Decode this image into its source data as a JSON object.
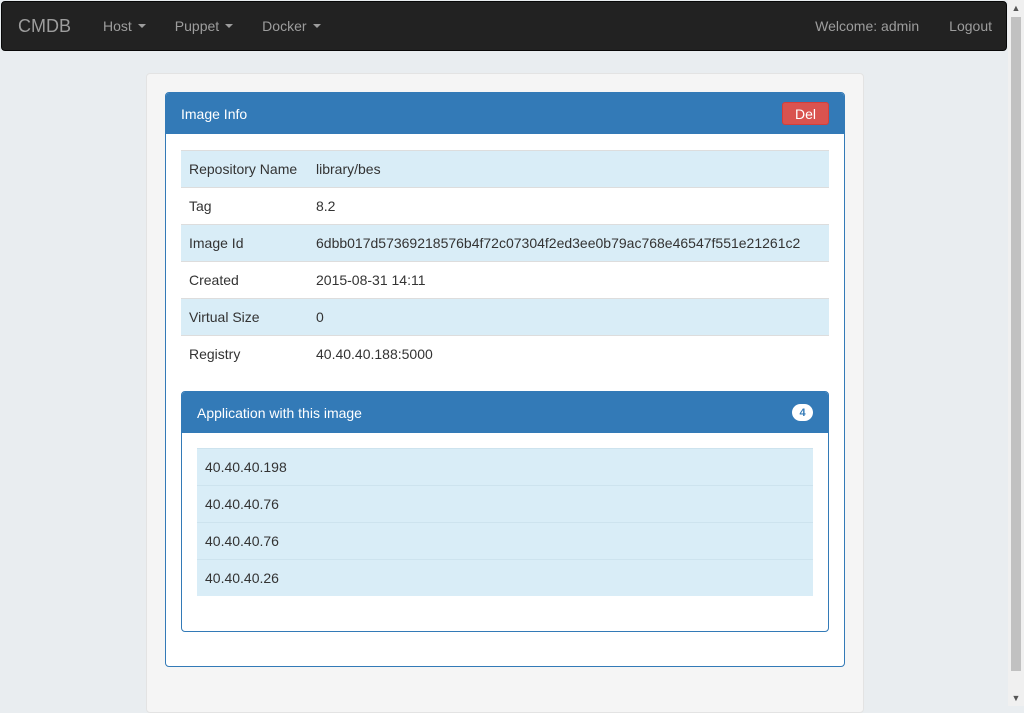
{
  "navbar": {
    "brand": "CMDB",
    "menus": [
      {
        "label": "Host"
      },
      {
        "label": "Puppet"
      },
      {
        "label": "Docker"
      }
    ],
    "welcome": "Welcome: admin",
    "logout": "Logout"
  },
  "image_panel": {
    "title": "Image Info",
    "del_label": "Del",
    "rows": [
      {
        "key": "Repository Name",
        "value": "library/bes"
      },
      {
        "key": "Tag",
        "value": "8.2"
      },
      {
        "key": "Image Id",
        "value": "6dbb017d57369218576b4f72c07304f2ed3ee0b79ac768e46547f551e21261c2"
      },
      {
        "key": "Created",
        "value": "2015-08-31 14:11"
      },
      {
        "key": "Virtual Size",
        "value": "0"
      },
      {
        "key": "Registry",
        "value": "40.40.40.188:5000"
      }
    ]
  },
  "app_panel": {
    "title": "Application with this image",
    "count": "4",
    "items": [
      "40.40.40.198",
      "40.40.40.76",
      "40.40.40.76",
      "40.40.40.26"
    ]
  },
  "colors": {
    "primary": "#337ab7",
    "danger": "#d9534f",
    "row_highlight": "#d9edf7",
    "navbar_bg": "#222222"
  }
}
